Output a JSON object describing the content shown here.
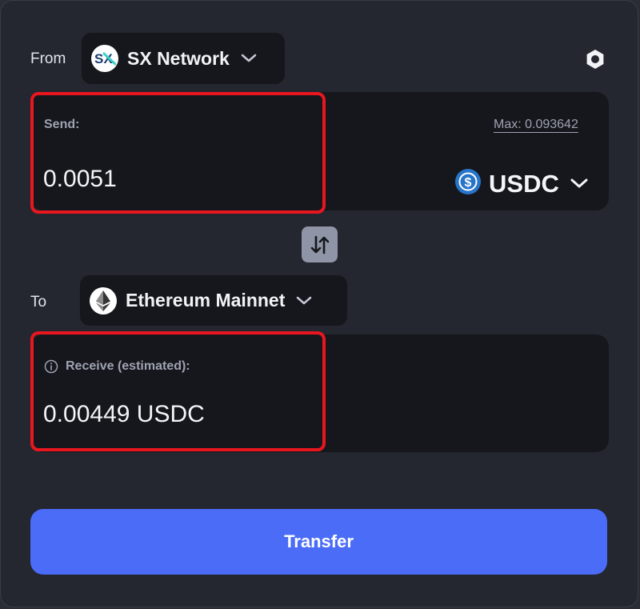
{
  "from": {
    "label": "From",
    "network": "SX Network",
    "logo_text": "SX"
  },
  "send": {
    "label": "Send:",
    "amount": "0.0051",
    "max_link": "Max: 0.093642",
    "token": "USDC",
    "token_icon": "usdc-icon"
  },
  "to": {
    "label": "To",
    "network": "Ethereum Mainnet",
    "network_icon": "ethereum-icon"
  },
  "receive": {
    "label": "Receive (estimated):",
    "amount": "0.00449 USDC"
  },
  "transfer_button": "Transfer",
  "colors": {
    "background": "#242630",
    "card": "#16171c",
    "accent": "#4a6cf7",
    "highlight": "#e8161e",
    "usdc": "#2775ca",
    "muted": "#9ea3b2"
  }
}
